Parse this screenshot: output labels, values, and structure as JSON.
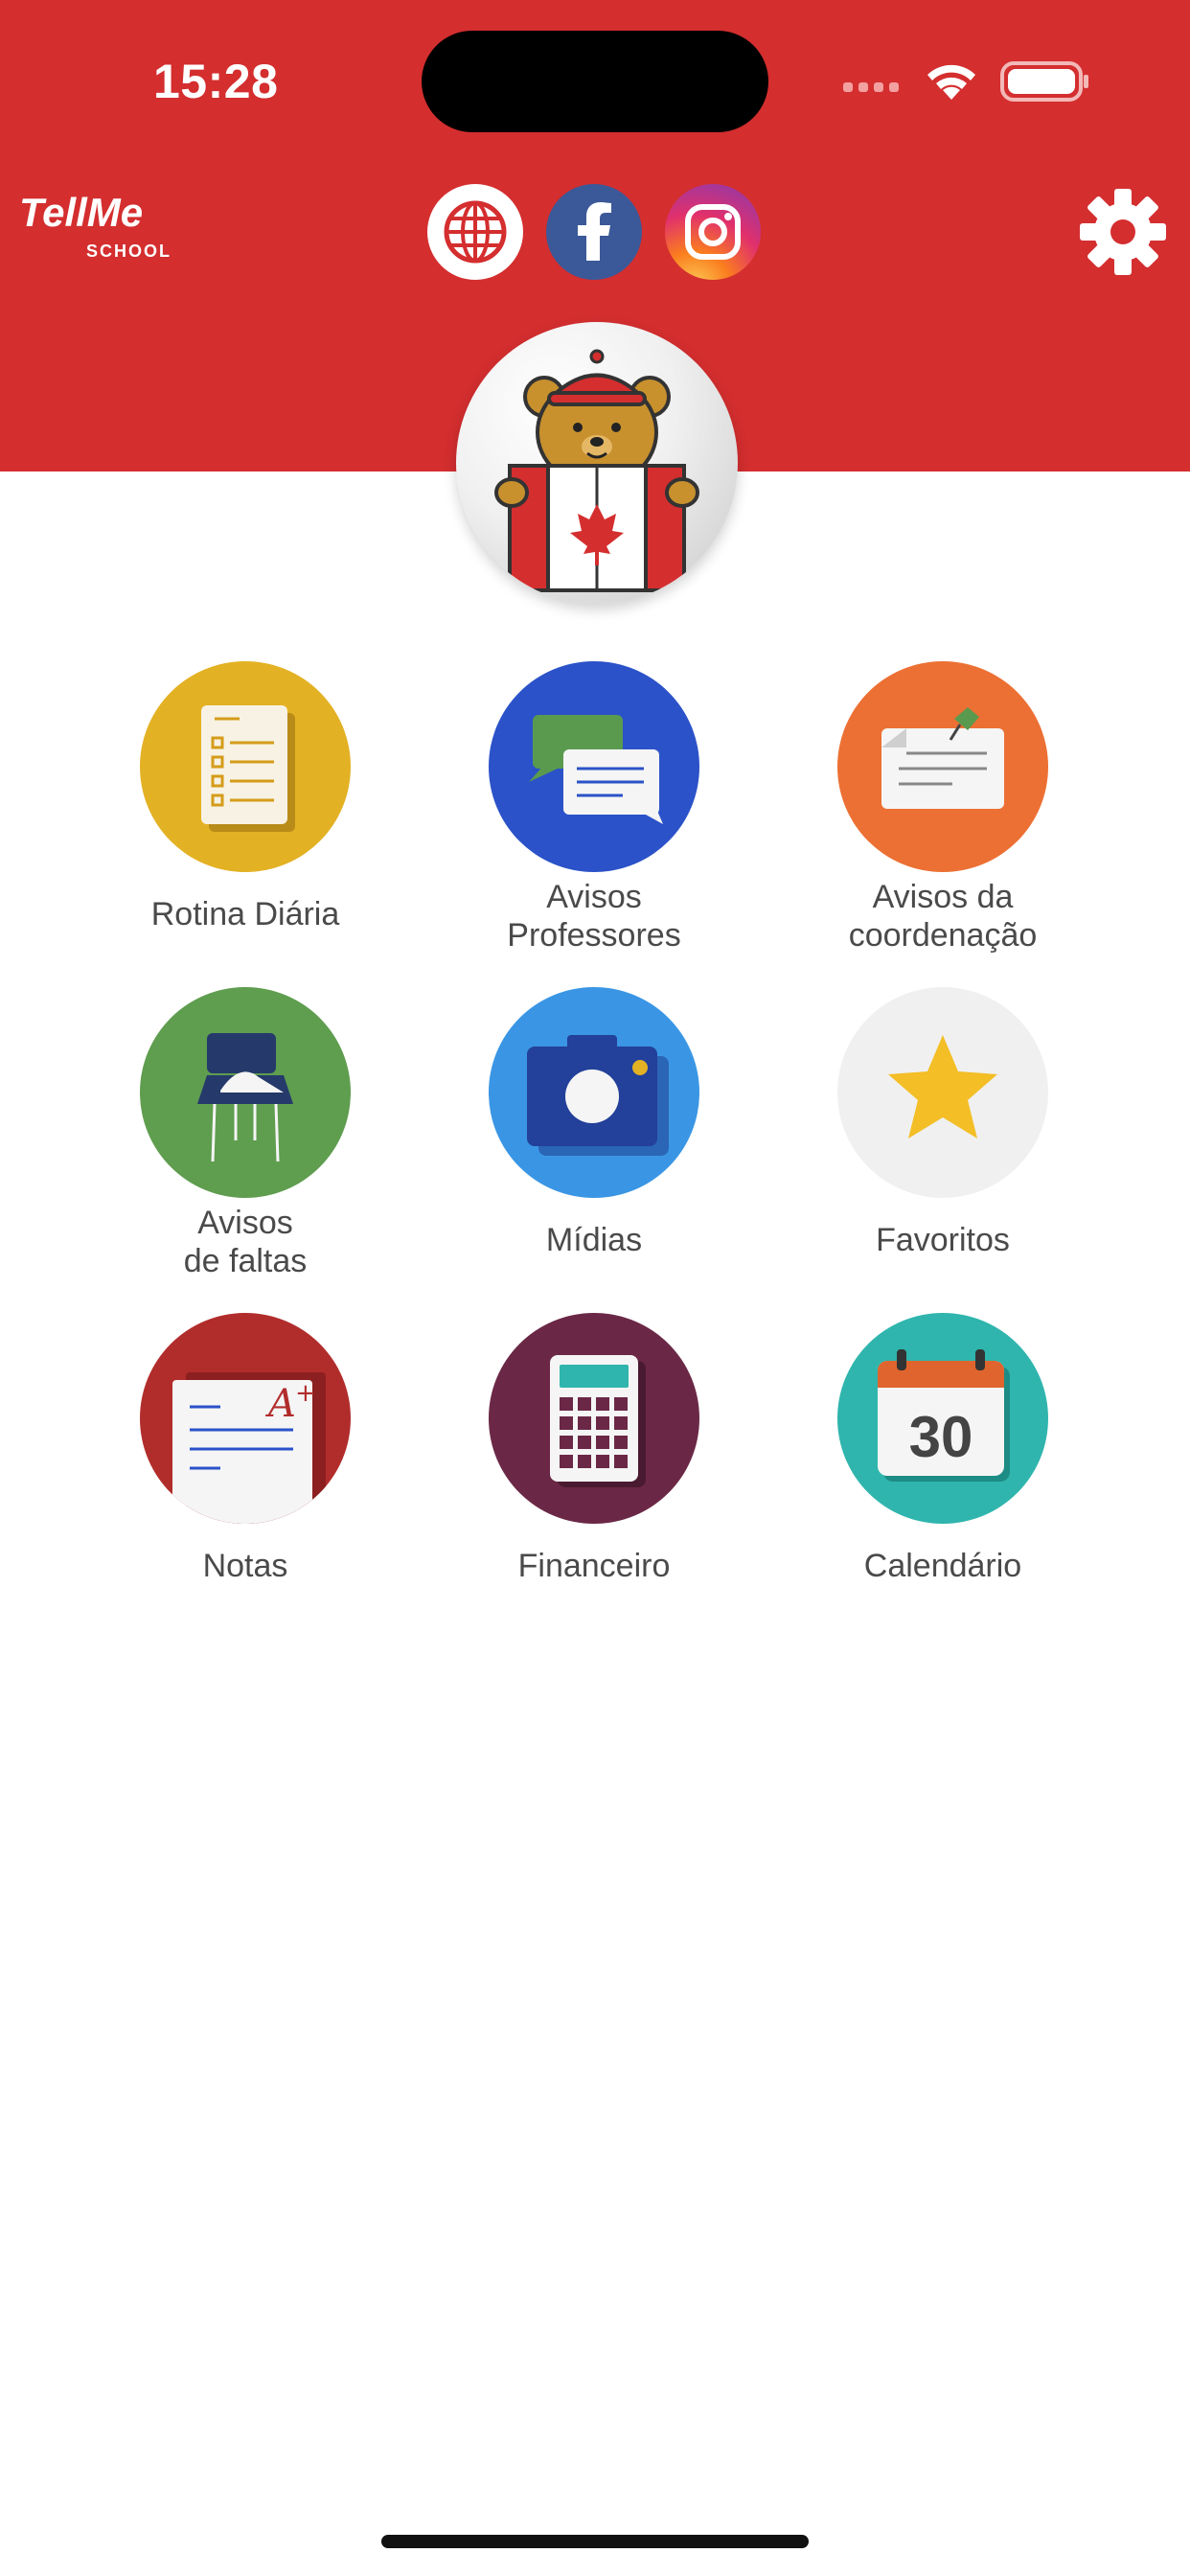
{
  "status_bar": {
    "time": "15:28"
  },
  "header": {
    "logo": {
      "line1": "TellMe",
      "line2": "SCHOOL"
    },
    "social": [
      "globe-icon",
      "facebook-icon",
      "instagram-icon"
    ],
    "settings_icon": "gear-icon"
  },
  "colors": {
    "header_red": "#d42e2f",
    "rotina": "#e3b124",
    "avisos_professores": "#2b52c8",
    "avisos_coordenacao": "#ec7033",
    "faltas": "#5f9d4f",
    "midias": "#3a96e4",
    "favoritos": "#f0f0f0",
    "notas": "#b12d2c",
    "financeiro": "#6b2846",
    "calendario": "#2fb5ad"
  },
  "menu": [
    {
      "label": "Rotina Diária",
      "icon": "checklist-icon"
    },
    {
      "label": "Avisos\nProfessores",
      "icon": "chat-bubbles-icon"
    },
    {
      "label": "Avisos da\ncoordenação",
      "icon": "pinned-note-icon"
    },
    {
      "label": "Avisos\nde faltas",
      "icon": "school-desk-icon"
    },
    {
      "label": "Mídias",
      "icon": "camera-icon"
    },
    {
      "label": "Favoritos",
      "icon": "star-icon"
    },
    {
      "label": "Notas",
      "icon": "graded-paper-icon"
    },
    {
      "label": "Financeiro",
      "icon": "calculator-icon"
    },
    {
      "label": "Calendário",
      "icon": "calendar-icon",
      "day": "30"
    }
  ]
}
